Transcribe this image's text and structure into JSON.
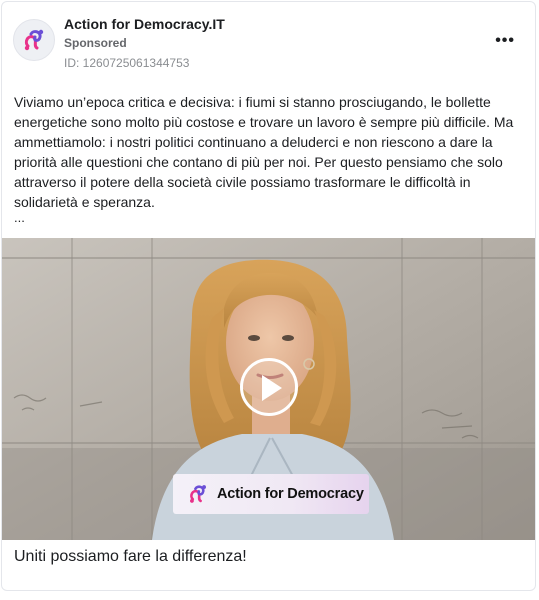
{
  "ad": {
    "page_name": "Action for Democracy.IT",
    "sponsored_label": "Sponsored",
    "ad_id": "ID: 1260725061344753",
    "more_label": "•••",
    "body": "Viviamo un’epoca critica e decisiva: i fiumi si stanno prosciugando, le bollette energetiche sono molto più costose e trovare un lavoro è sempre più difficile. Ma ammettiamolo: i nostri politici continuano a deluderci e non riescono a dare la priorità alle questioni che contano di più per noi. Per questo pensiamo che solo attraverso il potere della società civile possiamo trasformare le difficoltà in solidarietà e speranza.",
    "ellipsis": "...",
    "caption": "Uniti possiamo fare la differenza!"
  },
  "video": {
    "banner_text": "Action for Democracy",
    "play_icon": "play-icon"
  },
  "colors": {
    "brand_pink": "#e8318a",
    "brand_purple": "#6b4fd6",
    "muted_text": "#65676b"
  }
}
